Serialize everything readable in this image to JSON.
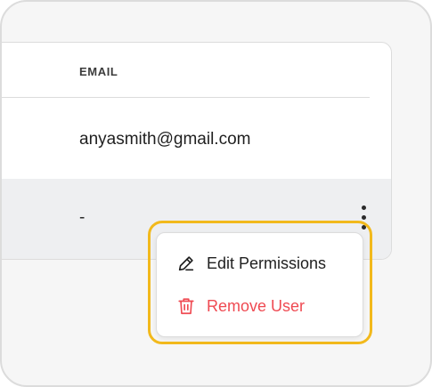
{
  "table": {
    "header_email": "EMAIL",
    "rows": [
      {
        "email": "anyasmith@gmail.com"
      },
      {
        "email": "-"
      }
    ]
  },
  "row_menu": {
    "items": [
      {
        "label": "Edit Permissions",
        "icon": "pencil-icon"
      },
      {
        "label": "Remove User",
        "icon": "trash-icon",
        "color": "#ef4a52"
      }
    ]
  },
  "colors": {
    "highlight": "#f2b91c",
    "danger": "#ef4a52",
    "row_hover": "#eeeff1"
  }
}
